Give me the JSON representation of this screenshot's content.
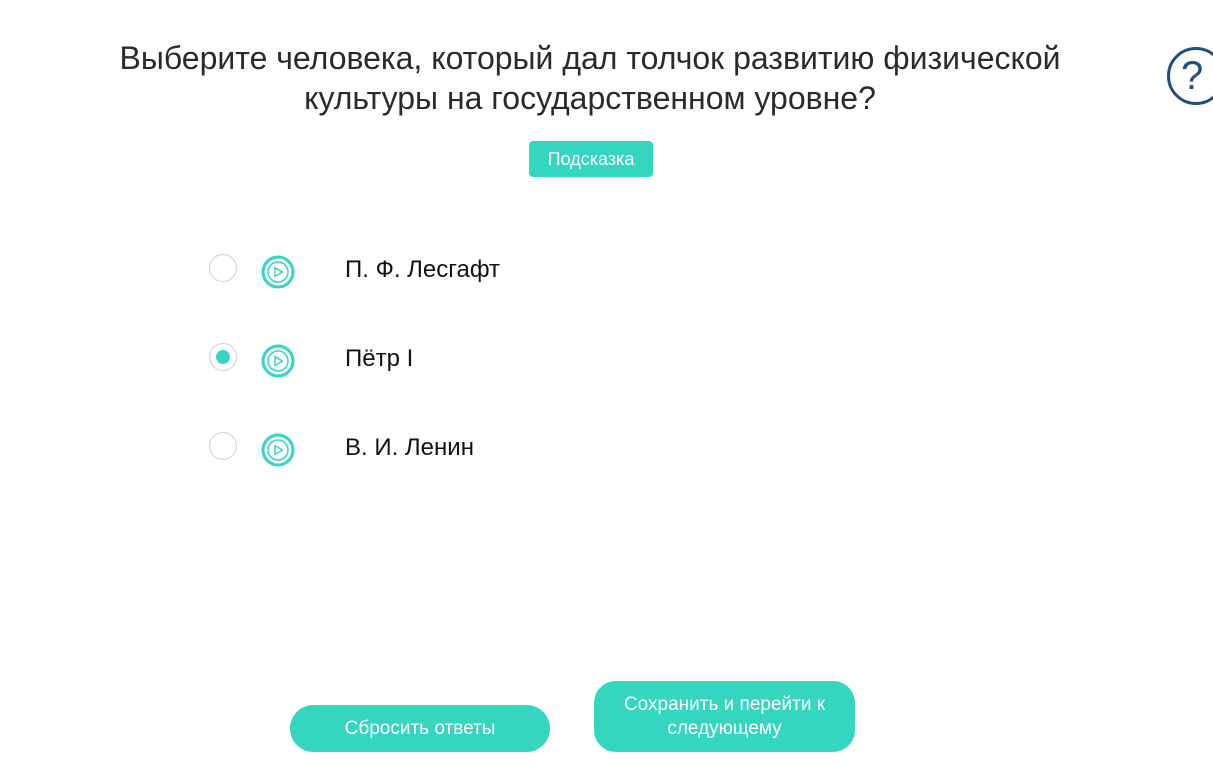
{
  "question": {
    "line1": "Выберите человека, который дал толчок развитию физической",
    "line2": "культуры на государственном уровне?"
  },
  "help_icon": "question-mark-icon",
  "hint_label": "Подсказка",
  "options": [
    {
      "label": "П. Ф. Лесгафт",
      "selected": false,
      "audio_icon": "play-icon"
    },
    {
      "label": "Пётр I",
      "selected": true,
      "audio_icon": "play-icon"
    },
    {
      "label": "В. И. Ленин",
      "selected": false,
      "audio_icon": "play-icon"
    }
  ],
  "buttons": {
    "reset_label": "Сбросить ответы",
    "next_label": "Сохранить и перейти к следующему"
  },
  "colors": {
    "accent": "#34d6c0",
    "help_icon": "#1f4f80"
  }
}
